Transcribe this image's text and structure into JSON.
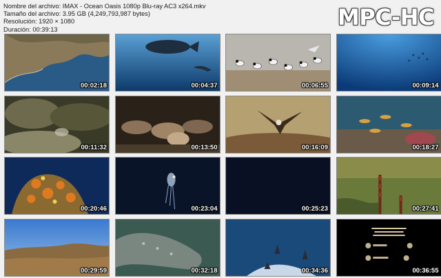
{
  "file_info": {
    "filename_line": "Nombre del archivo: IMAX - Ocean Oasis 1080p Blu-ray AC3 x264.mkv",
    "size_line": "Tamaño del archivo: 3.95 GB (4,249,793,987 bytes)",
    "resolution_line": "Resolución: 1920 × 1080",
    "duration_line": "Duración: 00:39:13"
  },
  "logo": "MPC-HC",
  "thumbnails": [
    {
      "timestamp": "00:02:18",
      "scene": "aerial-coastline"
    },
    {
      "timestamp": "00:04:37",
      "scene": "whale-shark-underwater"
    },
    {
      "timestamp": "00:06:55",
      "scene": "seabirds-on-beach"
    },
    {
      "timestamp": "00:09:14",
      "scene": "open-blue-water"
    },
    {
      "timestamp": "00:11:32",
      "scene": "rocky-seafloor"
    },
    {
      "timestamp": "00:13:50",
      "scene": "sea-lions-on-rocks"
    },
    {
      "timestamp": "00:16:09",
      "scene": "osprey-on-nest"
    },
    {
      "timestamp": "00:18:27",
      "scene": "reef-fish"
    },
    {
      "timestamp": "00:20:46",
      "scene": "orange-coral-reef"
    },
    {
      "timestamp": "00:23:04",
      "scene": "jellyfish-dark-water"
    },
    {
      "timestamp": "00:25:23",
      "scene": "dark-frame"
    },
    {
      "timestamp": "00:27:41",
      "scene": "desert-plants"
    },
    {
      "timestamp": "00:29:59",
      "scene": "desert-shrubland"
    },
    {
      "timestamp": "00:32:18",
      "scene": "gray-whale-closeup"
    },
    {
      "timestamp": "00:34:36",
      "scene": "dolphins-in-water"
    },
    {
      "timestamp": "00:36:55",
      "scene": "end-credits-logos"
    }
  ]
}
